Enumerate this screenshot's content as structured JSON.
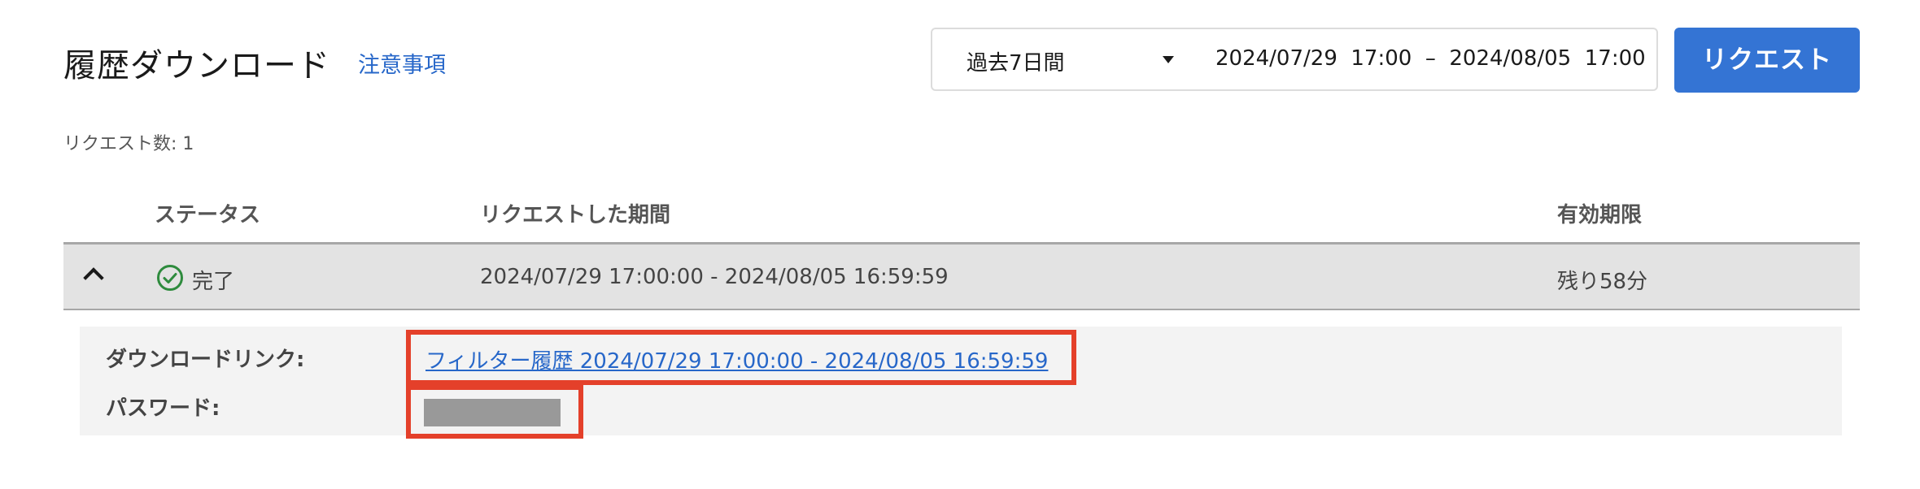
{
  "header": {
    "title": "履歴ダウンロード",
    "notes_link": "注意事項"
  },
  "filter": {
    "period_selected": "過去7日間",
    "date_range": "2024/07/29  17:00  –  2024/08/05  17:00",
    "request_button": "リクエスト"
  },
  "summary": {
    "request_count": "リクエスト数: 1"
  },
  "table": {
    "columns": [
      "ステータス",
      "リクエストした期間",
      "有効期限"
    ],
    "rows": [
      {
        "status": "完了",
        "period": "2024/07/29 17:00:00 - 2024/08/05 16:59:59",
        "expiry": "残り58分"
      }
    ]
  },
  "details": {
    "download_link_label": "ダウンロードリンク:",
    "download_link_text": "フィルター履歴 2024/07/29 17:00:00 - 2024/08/05 16:59:59",
    "password_label": "パスワード:"
  },
  "colors": {
    "accent": "#3474d4",
    "link": "#2767c9",
    "highlight": "#e4402a",
    "success": "#2e8b3d",
    "row_bg": "#e3e3e3",
    "details_bg": "#f3f3f3"
  },
  "icons": {
    "status": "check-circle-icon",
    "expand": "chevron-up-icon",
    "dropdown": "caret-down-icon"
  }
}
